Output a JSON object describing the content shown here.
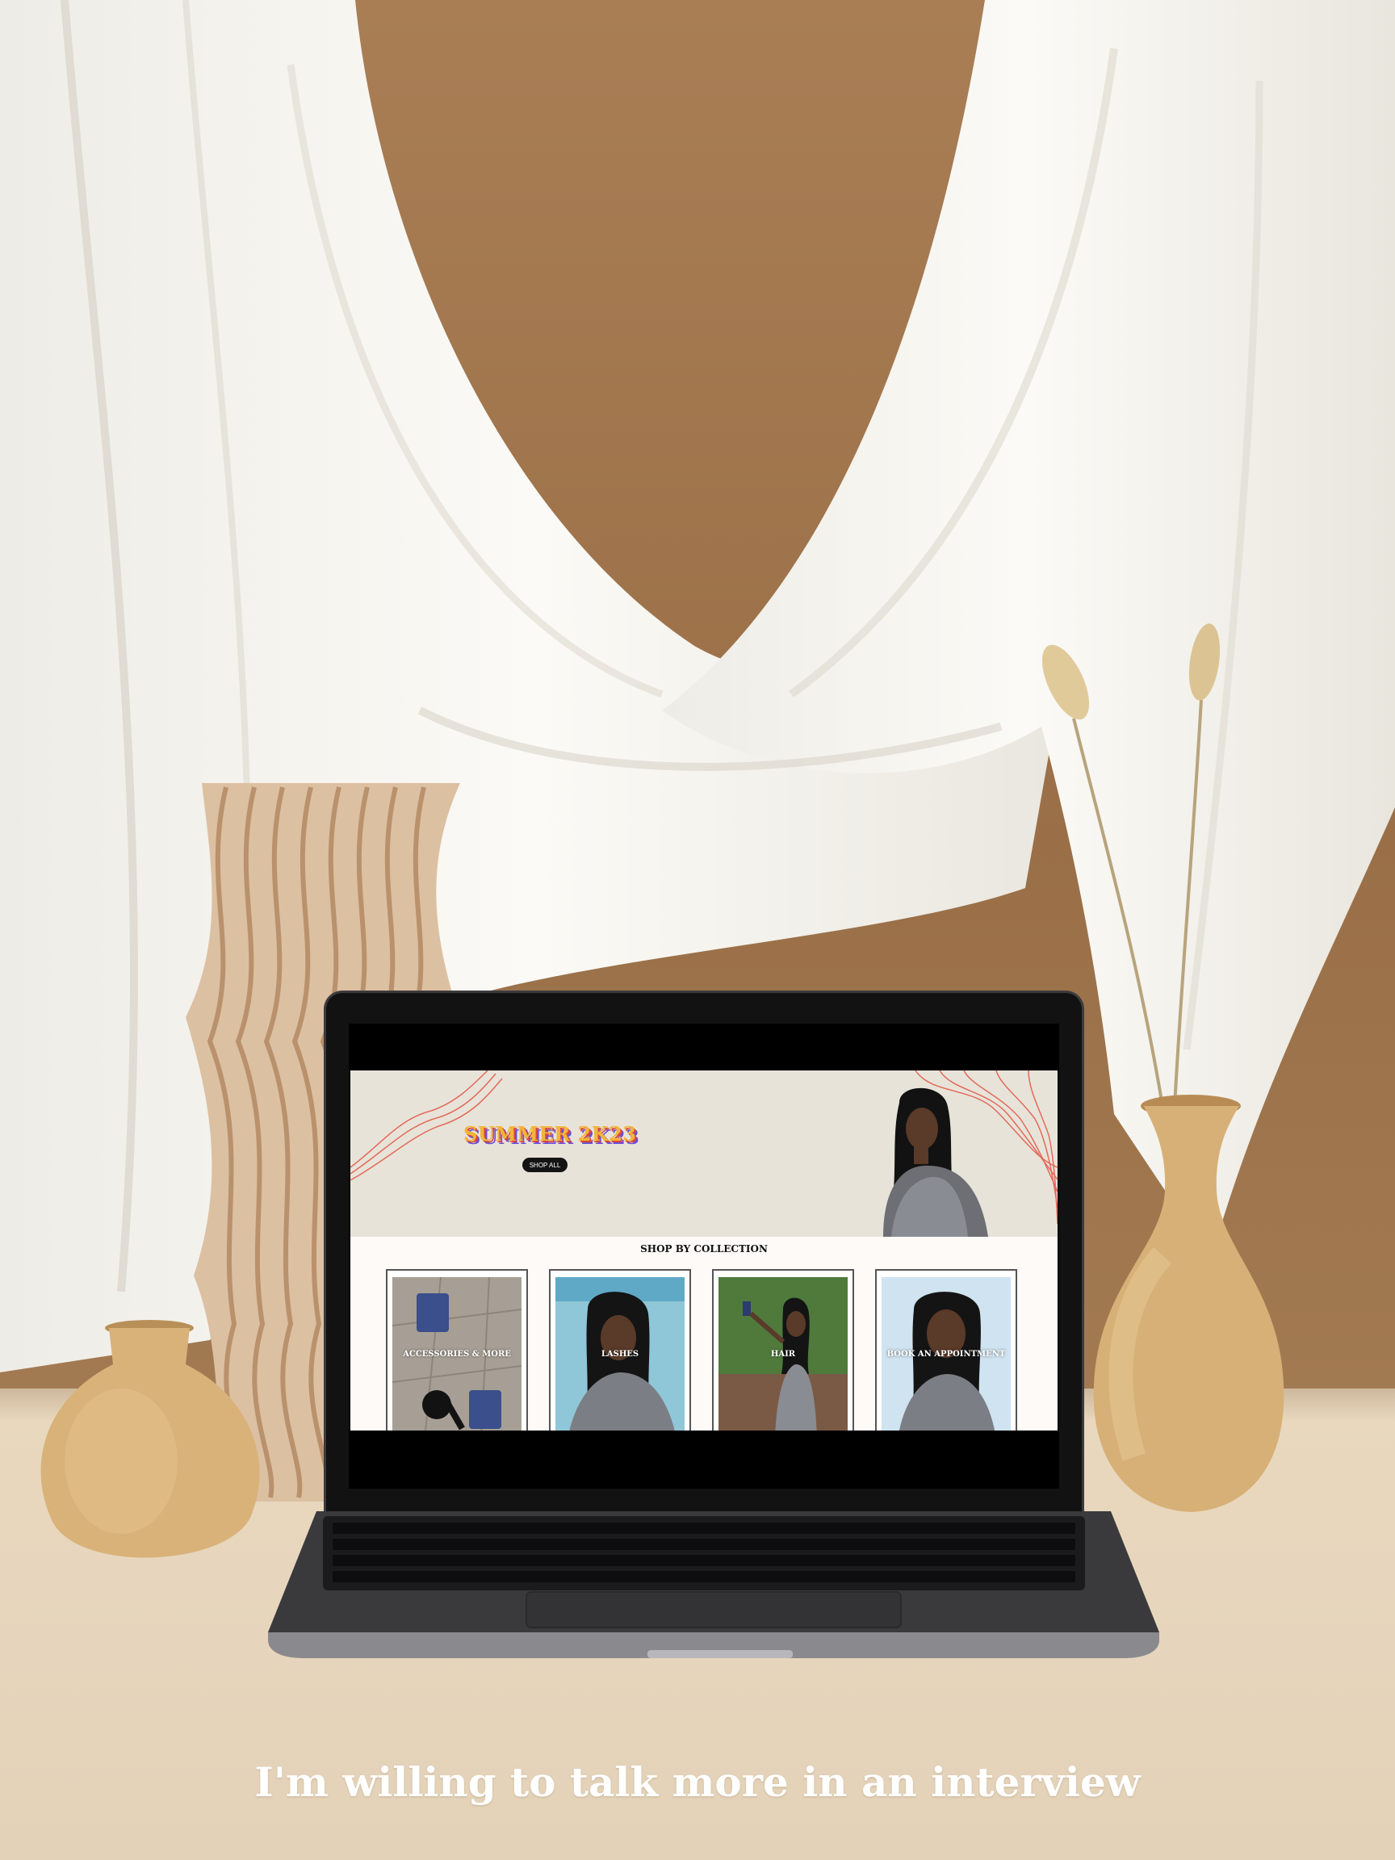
{
  "scene": {
    "caption": "I'm willing to talk more in an interview"
  },
  "website": {
    "hero": {
      "title": "SUMMER 2K23",
      "button_label": "SHOP ALL"
    },
    "collection": {
      "title": "SHOP BY COLLECTION",
      "cards": [
        {
          "label": "ACCESSORIES & MORE"
        },
        {
          "label": "LASHES"
        },
        {
          "label": "HAIR"
        },
        {
          "label": "BOOK AN APPOINTMENT"
        }
      ]
    }
  },
  "colors": {
    "backdrop": "#a27a52",
    "drape": "#f5f4ef",
    "table": "#e6d7bf",
    "hero_bg": "#e8e3d9",
    "title_yellow": "#f2b43a",
    "title_red": "#d9463b",
    "title_purple": "#6b4ed6",
    "line_red": "#e26a5a",
    "laptop": "#2c2c2f"
  }
}
